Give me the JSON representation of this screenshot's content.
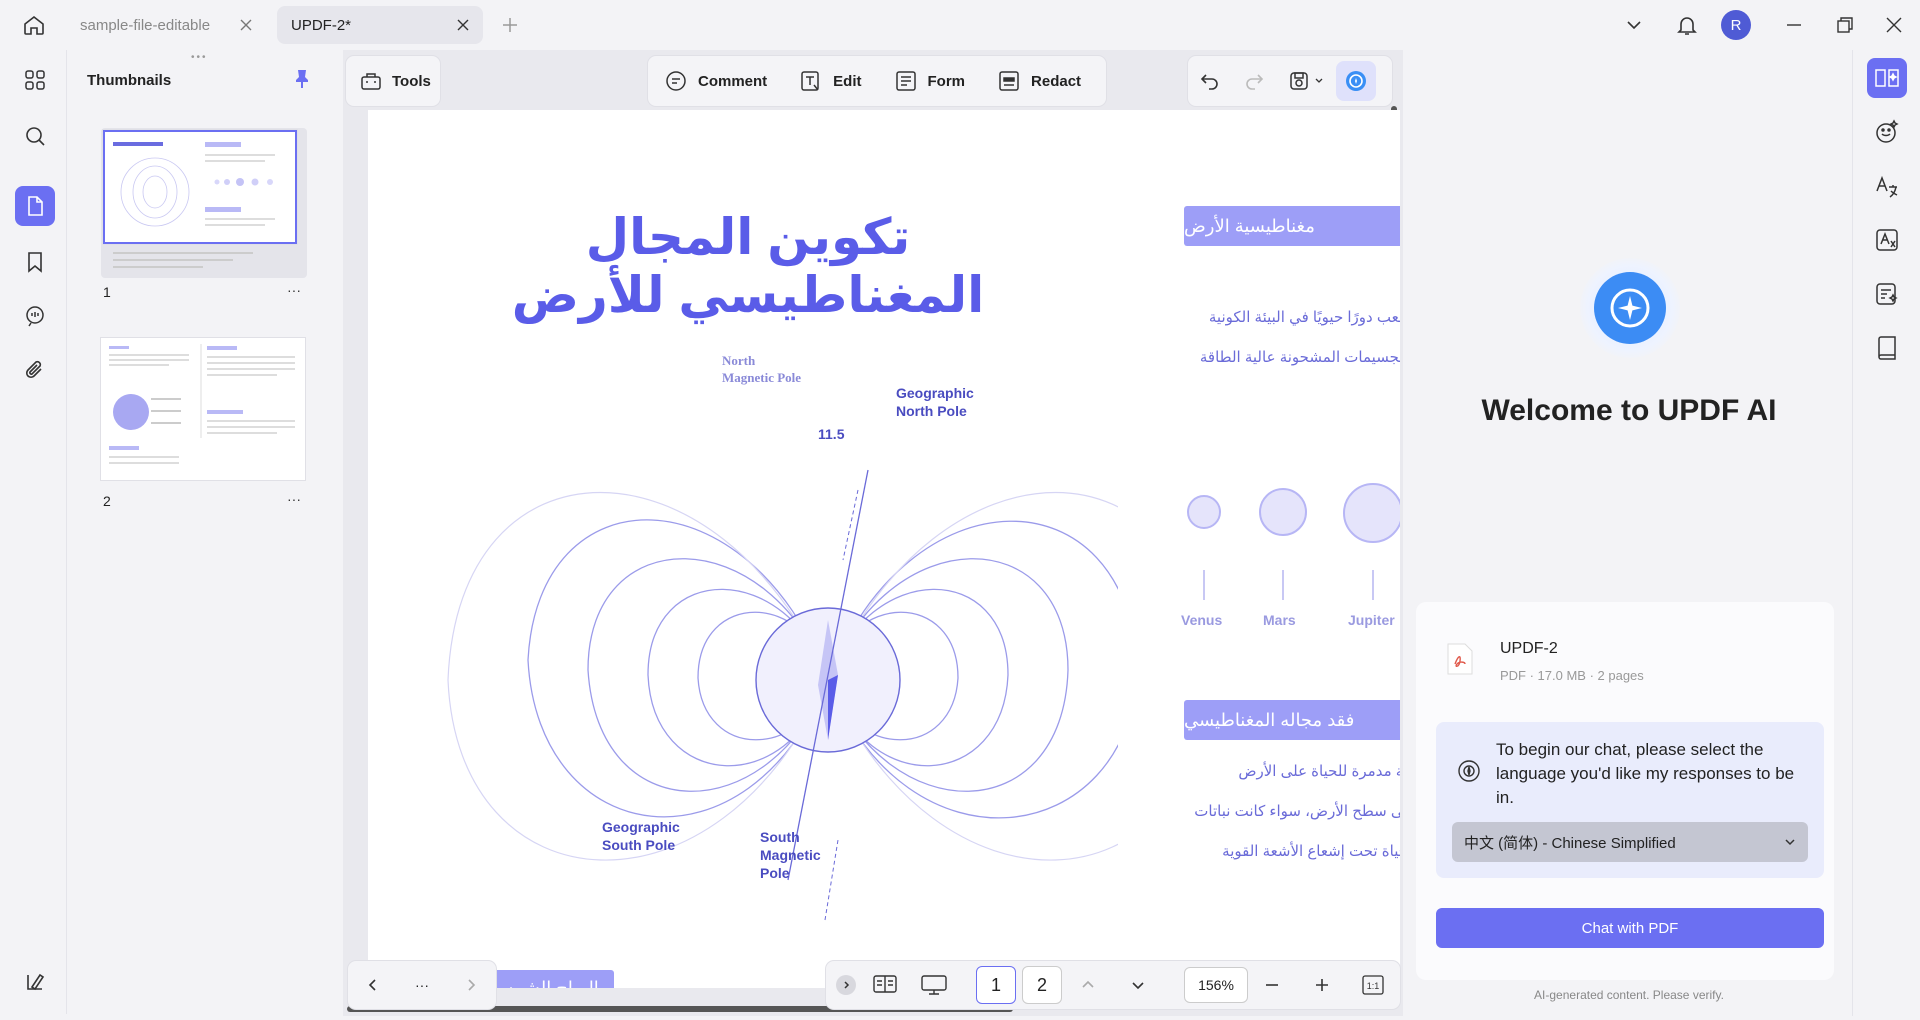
{
  "tabs": [
    {
      "label": "sample-file-editable"
    },
    {
      "label": "UPDF-2*"
    }
  ],
  "user": {
    "avatar_letter": "R"
  },
  "thumbnails": {
    "title": "Thumbnails",
    "pages": [
      {
        "number": "1"
      },
      {
        "number": "2"
      }
    ],
    "more_label": "···"
  },
  "toolbar": {
    "tools_label": "Tools",
    "comment_label": "Comment",
    "edit_label": "Edit",
    "form_label": "Form",
    "redact_label": "Redact"
  },
  "document": {
    "title": "تكوين المجال المغناطيسي للأرض",
    "section1_header": "مغناطيسية الأرض",
    "section1_lines": [
      "يلعب دورًا حيويًا في البيئة الكونية",
      "الجسيمات المشحونة عالية الطاقة"
    ],
    "section2_header": "فقد مجاله المغناطيسي",
    "section2_lines": [
      "ية مدمرة للحياة على الأرض",
      "لى سطح الأرض، سواء كانت نباتات",
      "حياة تحت إشعاع الأشعة القوية"
    ],
    "bottom_header": "الرياح الشمسية",
    "planets": [
      "Venus",
      "Mars",
      "Jupiter"
    ],
    "diagram_labels": {
      "north_magnetic": "North Magnetic Pole",
      "geographic_north": "Geographic North Pole",
      "angle": "11.5",
      "geographic_south": "Geographic South Pole",
      "south_magnetic": "South Magnetic Pole"
    }
  },
  "pager": {
    "more": "···",
    "current_page": "1",
    "other_page": "2",
    "zoom": "156%"
  },
  "ai": {
    "welcome": "Welcome to UPDF AI",
    "file_name": "UPDF-2",
    "file_meta": "PDF · 17.0 MB · 2 pages",
    "prompt": "To begin our chat, please select the language you'd like my responses to be in.",
    "language": "中文 (简体) - Chinese Simplified",
    "chat_button": "Chat with PDF",
    "disclaimer": "AI-generated content. Please verify."
  },
  "colors": {
    "accent": "#6b6ff2",
    "doc_blue": "#5a5ce8",
    "bar": "#9d9ef7"
  }
}
